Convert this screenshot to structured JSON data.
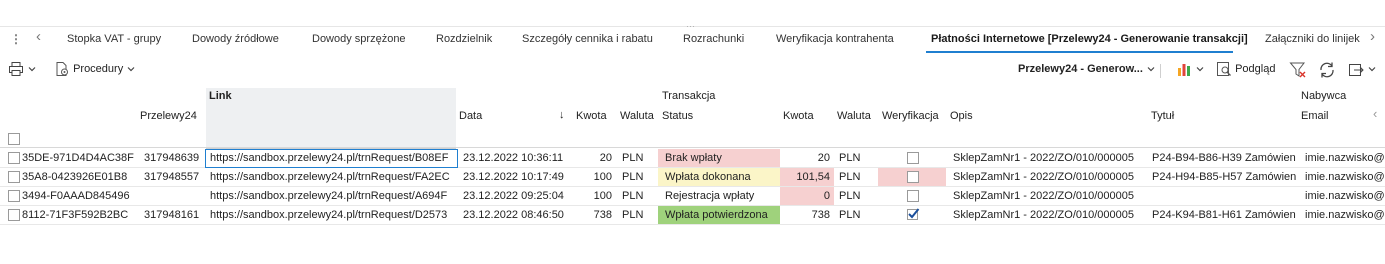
{
  "tabs": {
    "items": [
      {
        "label": "Stopka VAT - grupy",
        "active": false
      },
      {
        "label": "Dowody źródłowe",
        "active": false
      },
      {
        "label": "Dowody sprzężone",
        "active": false
      },
      {
        "label": "Rozdzielnik",
        "active": false
      },
      {
        "label": "Szczegóły cennika i rabatu",
        "active": false
      },
      {
        "label": "Rozrachunki",
        "active": false
      },
      {
        "label": "Weryfikacja kontrahenta",
        "active": false
      },
      {
        "label": "Płatności Internetowe [Przelewy24 - Generowanie transakcji]",
        "active": true
      },
      {
        "label": "Załączniki do linijek",
        "active": false
      }
    ],
    "more_glyph": "⋮",
    "prev_glyph": "‹",
    "next_glyph": "›",
    "grip_glyph": "⋯"
  },
  "toolbar": {
    "procedures_label": "Procedury",
    "view_selector_label": "Przelewy24 - Generow...",
    "preview_label": "Podgląd"
  },
  "grid": {
    "group_headers": {
      "link": "Link",
      "transakcja": "Transakcja",
      "nabywca": "Nabywca"
    },
    "columns": {
      "przelewy24": "Przelewy24",
      "data": "Data",
      "kwota": "Kwota",
      "waluta": "Waluta",
      "status": "Status",
      "kwota2": "Kwota",
      "waluta2": "Waluta",
      "weryfikacja": "Weryfikacja",
      "opis": "Opis",
      "tytul": "Tytuł",
      "email": "Email"
    },
    "rows": [
      {
        "id": "35DE-971D4D4AC38F",
        "p24": "317948639",
        "link": "https://sandbox.przelewy24.pl/trnRequest/B08EF",
        "data": "23.12.2022 10:36:11",
        "kwota": "20",
        "waluta": "PLN",
        "status": "Brak wpłaty",
        "status_color": "#f6d0d0",
        "kwota2": "20",
        "kwota2_color": "",
        "waluta2": "PLN",
        "wer_checked": false,
        "wer_bg": "",
        "opis": "SklepZamNr1 - 2022/ZO/010/000005",
        "tytul": "P24-B94-B86-H39 Zamówien",
        "email": "imie.nazwisko@"
      },
      {
        "id": "35A8-0423926E01B8",
        "p24": "317948557",
        "link": "https://sandbox.przelewy24.pl/trnRequest/FA2EC",
        "data": "23.12.2022 10:17:49",
        "kwota": "100",
        "waluta": "PLN",
        "status": "Wpłata dokonana",
        "status_color": "#fbf5c8",
        "kwota2": "101,54",
        "kwota2_color": "#f6d0d0",
        "waluta2": "PLN",
        "wer_checked": false,
        "wer_bg": "#f6d0d0",
        "opis": "SklepZamNr1 - 2022/ZO/010/000005",
        "tytul": "P24-H94-B85-H57 Zamówien",
        "email": "imie.nazwisko@"
      },
      {
        "id": "3494-F0AAAD845496",
        "p24": "",
        "link": "https://sandbox.przelewy24.pl/trnRequest/A694F",
        "data": "23.12.2022 09:25:04",
        "kwota": "100",
        "waluta": "PLN",
        "status": "Rejestracja wpłaty",
        "status_color": "",
        "kwota2": "0",
        "kwota2_color": "#f6d0d0",
        "waluta2": "PLN",
        "wer_checked": false,
        "wer_bg": "",
        "opis": "SklepZamNr1 - 2022/ZO/010/000005",
        "tytul": "",
        "email": "imie.nazwisko@"
      },
      {
        "id": "8112-71F3F592B2BC",
        "p24": "317948161",
        "link": "https://sandbox.przelewy24.pl/trnRequest/D2573",
        "data": "23.12.2022 08:46:50",
        "kwota": "738",
        "waluta": "PLN",
        "status": "Wpłata potwierdzona",
        "status_color": "#9fd27c",
        "kwota2": "738",
        "kwota2_color": "",
        "waluta2": "PLN",
        "wer_checked": true,
        "wer_bg": "",
        "opis": "SklepZamNr1 - 2022/ZO/010/000005",
        "tytul": "P24-K94-B81-H61 Zamówien",
        "email": "imie.nazwisko@"
      }
    ]
  },
  "colors": {
    "accent": "#1f7fd0"
  }
}
